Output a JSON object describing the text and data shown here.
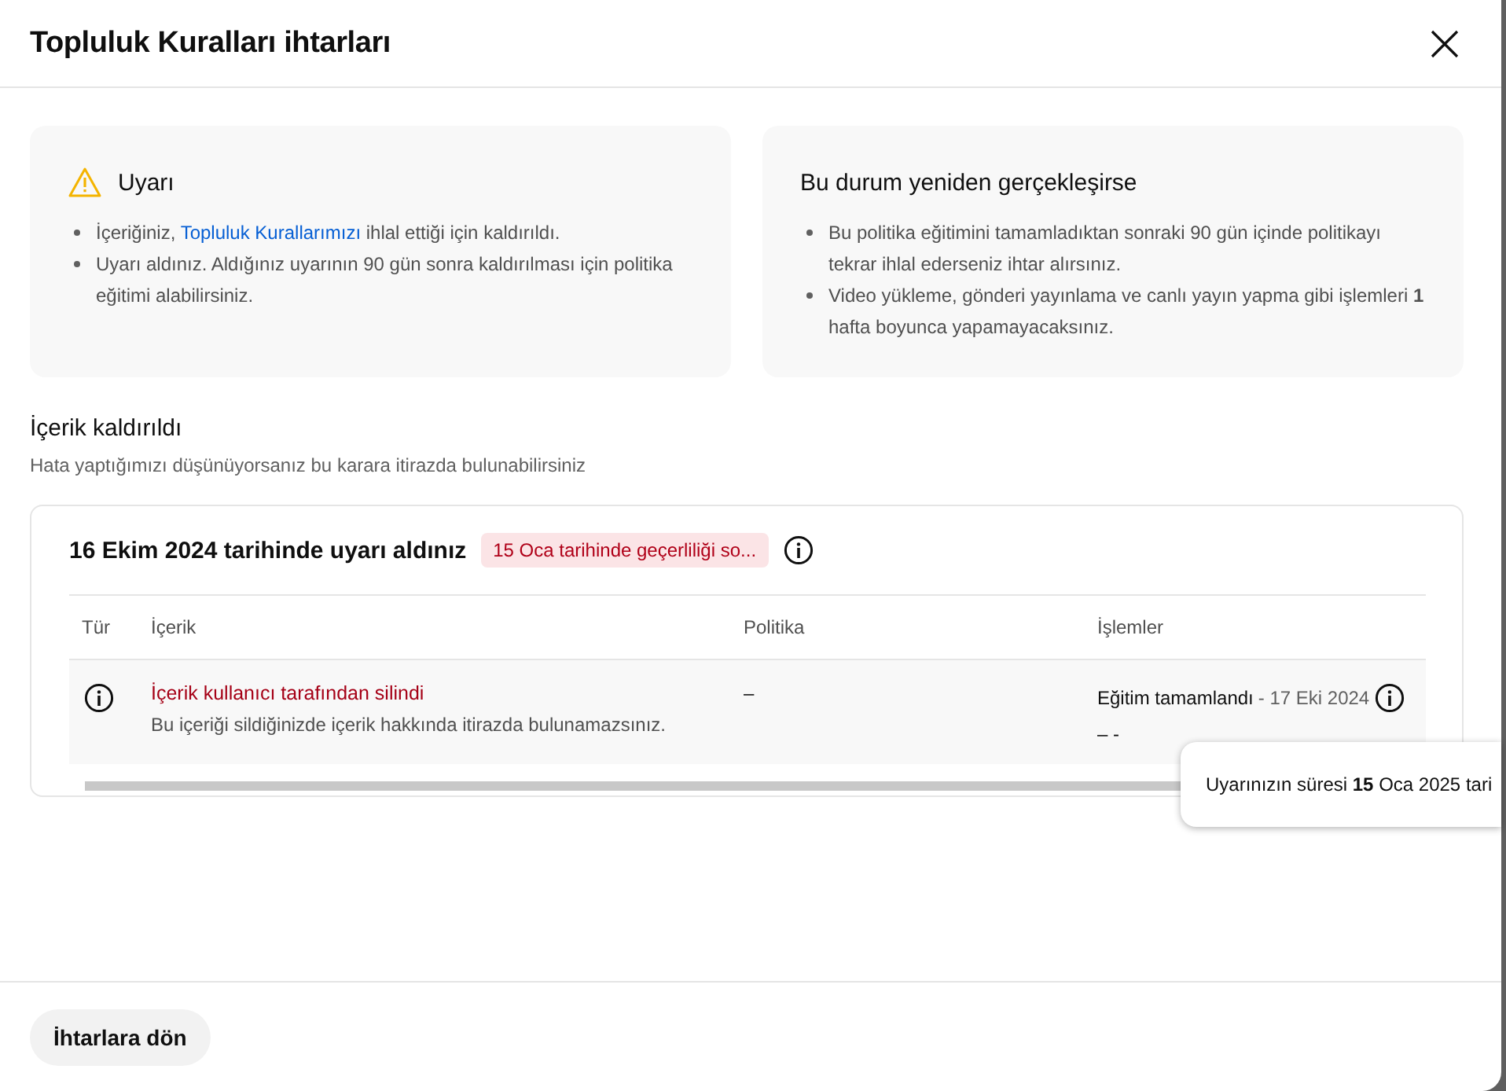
{
  "dialog": {
    "title": "Topluluk Kuralları ihtarları"
  },
  "cards": [
    {
      "kind": "warning",
      "title": "Uyarı",
      "bullets": [
        [
          {
            "kind": "text",
            "text": "İçeriğiniz, "
          },
          {
            "kind": "link",
            "text": "Topluluk Kurallarımızı"
          },
          {
            "kind": "text",
            "text": " ihlal ettiği için kaldırıldı."
          }
        ],
        [
          {
            "kind": "text",
            "text": "Uyarı aldınız. Aldığınız uyarının 90 gün sonra kaldırılması için politika eğitimi alabilirsiniz."
          }
        ]
      ]
    },
    {
      "kind": "plain",
      "title": "Bu durum yeniden gerçekleşirse",
      "bullets": [
        [
          {
            "kind": "text",
            "text": "Bu politika eğitimini tamamladıktan sonraki 90 gün içinde politikayı tekrar ihlal ederseniz ihtar alırsınız."
          }
        ],
        [
          {
            "kind": "text",
            "text": "Video yükleme, gönderi yayınlama ve canlı yayın yapma gibi işlemleri **1** hafta boyunca yapamayacaksınız."
          }
        ]
      ]
    }
  ],
  "section": {
    "title": "İçerik kaldırıldı",
    "subtitle": "Hata yaptığımızı düşünüyorsanız bu karara itirazda bulunabilirsiniz"
  },
  "strike": {
    "title": "16 Ekim 2024 tarihinde uyarı aldınız",
    "badge": "15 Oca tarihinde geçerliliği so...",
    "table": {
      "columns": [
        "Tür",
        "İçerik",
        "Politika",
        "İşlemler"
      ],
      "rows": [
        {
          "content_title": "İçerik kullanıcı tarafından silindi",
          "content_note": "Bu içeriği sildiğinizde içerik hakkında itirazda bulunamazsınız.",
          "policy": "–",
          "action": "Eğitim tamamlandı",
          "action_date": "- 17 Eki 2024",
          "action_note": "– -"
        }
      ]
    }
  },
  "tooltip": "Uyarınızın süresi **15** Oca 2025 tari",
  "footer": {
    "button": "İhtarlara dön"
  }
}
